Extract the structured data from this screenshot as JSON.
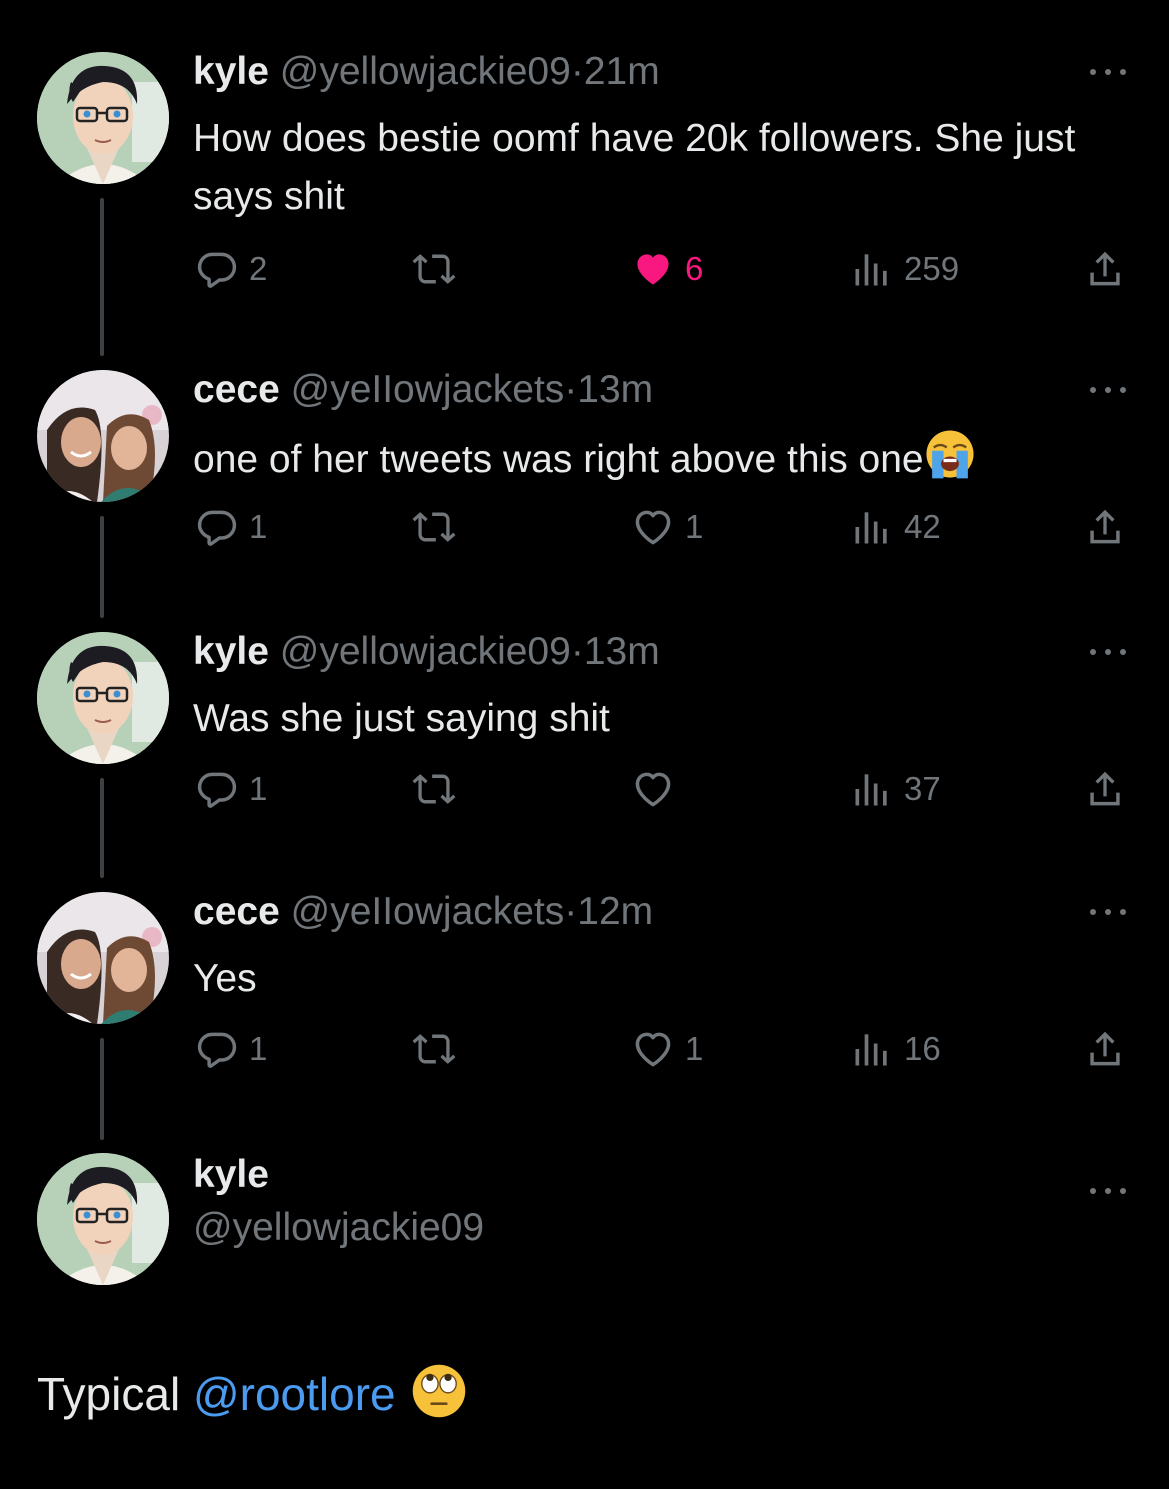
{
  "tweets": [
    {
      "name": "kyle",
      "handle": "@yellowjackie09",
      "dot": "·",
      "time": "21m",
      "text": "How does bestie oomf have 20k followers. She just says shit",
      "replies": "2",
      "likes": "6",
      "liked": true,
      "views": "259",
      "avatar": "cartoon-man-glasses"
    },
    {
      "name": "cece",
      "handle": "@yeIIowjackets",
      "dot": "·",
      "time": "13m",
      "text": "one of her tweets was right above this one",
      "emoji": "loudly-crying-face",
      "replies": "1",
      "likes": "1",
      "liked": false,
      "views": "42",
      "avatar": "two-girls-photo"
    },
    {
      "name": "kyle",
      "handle": "@yellowjackie09",
      "dot": "·",
      "time": "13m",
      "text": "Was she just saying shit",
      "replies": "1",
      "likes": "",
      "liked": false,
      "views": "37",
      "avatar": "cartoon-man-glasses"
    },
    {
      "name": "cece",
      "handle": "@yeIIowjackets",
      "dot": "·",
      "time": "12m",
      "text": "Yes",
      "replies": "1",
      "likes": "1",
      "liked": false,
      "views": "16",
      "avatar": "two-girls-photo"
    }
  ],
  "composer": {
    "name": "kyle",
    "handle": "@yellowjackie09",
    "avatar": "cartoon-man-glasses"
  },
  "footer": {
    "text": "Typical ",
    "mention": "@rootlore",
    "emoji": "face-with-rolling-eyes"
  },
  "colors": {
    "background": "#000000",
    "text": "#e7e9ea",
    "muted": "#71767b",
    "like": "#f91880",
    "mention": "#4b9bf0"
  }
}
